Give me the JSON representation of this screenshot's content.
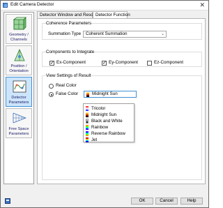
{
  "window": {
    "title": "Edit Camera Detector",
    "close_glyph": "✕"
  },
  "sidebar": {
    "items": [
      {
        "label": "Geometry / Channels",
        "icon": "geometry-channels-icon"
      },
      {
        "label": "Position / Orientation",
        "icon": "position-orientation-icon"
      },
      {
        "label": "Detector Parameters",
        "icon": "detector-parameters-icon",
        "active": true
      },
      {
        "label": "Free Space Parameters",
        "icon": "free-space-icon"
      }
    ]
  },
  "tabs": [
    {
      "label": "Detector Window and Resolution"
    },
    {
      "label": "Detector Function",
      "active": true
    }
  ],
  "coherence": {
    "title": "Coherence Parameters",
    "summation_label": "Summation Type",
    "summation_value": "Coherent Summation"
  },
  "components": {
    "title": "Components to Integrate",
    "ex": {
      "label": "Ex-Component",
      "checked": true
    },
    "ey": {
      "label": "Ey-Component",
      "checked": true
    },
    "ez": {
      "label": "Ez-Component",
      "checked": false
    }
  },
  "view": {
    "title": "View Settings of Result",
    "real_color": "Real Color",
    "false_color": "False Color",
    "colormap_value": "Midnight Sun"
  },
  "colormaps": [
    "Tricolor",
    "Midnight Sun",
    "Black and White",
    "Rainbow",
    "Reverse Rainbow",
    "Jet"
  ],
  "buttons": {
    "ok": "OK",
    "cancel": "Cancel",
    "help": "Help"
  }
}
